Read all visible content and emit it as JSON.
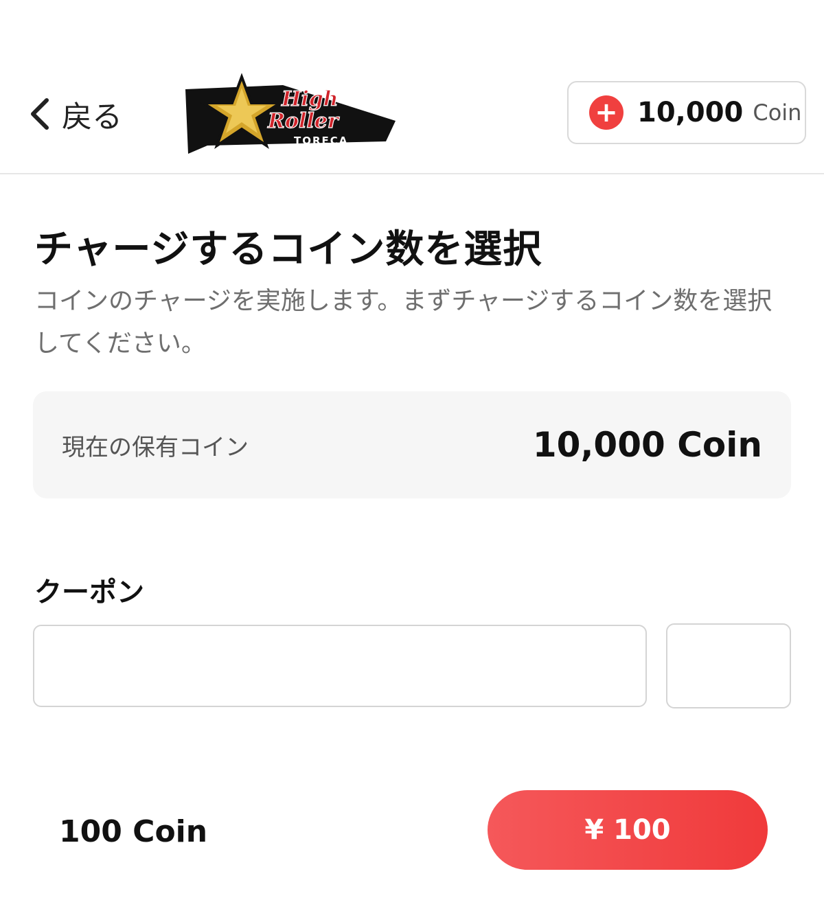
{
  "header": {
    "back_label": "戻る",
    "logo": {
      "line1": "High",
      "line2": "Roller",
      "sub": "TORECA"
    },
    "coin_balance": "10,000",
    "coin_unit": "Coin",
    "plus_symbol": "+"
  },
  "main": {
    "title": "チャージするコイン数を選択",
    "description": "コインのチャージを実施します。まずチャージするコイン数を選択してください。",
    "balance_card": {
      "label": "現在の保有コイン",
      "value": "10,000 Coin"
    },
    "coupon": {
      "label": "クーポン",
      "input_value": "",
      "placeholder": "",
      "apply_label": ""
    }
  },
  "footer": {
    "selected_coin": "100 Coin",
    "pay_label": "¥ 100"
  },
  "colors": {
    "accent": "#f0403f",
    "star_gold": "#d4a52a",
    "logo_red": "#d0232a"
  },
  "icons": {
    "back": "chevron-left-icon",
    "plus": "plus-circle-icon"
  }
}
